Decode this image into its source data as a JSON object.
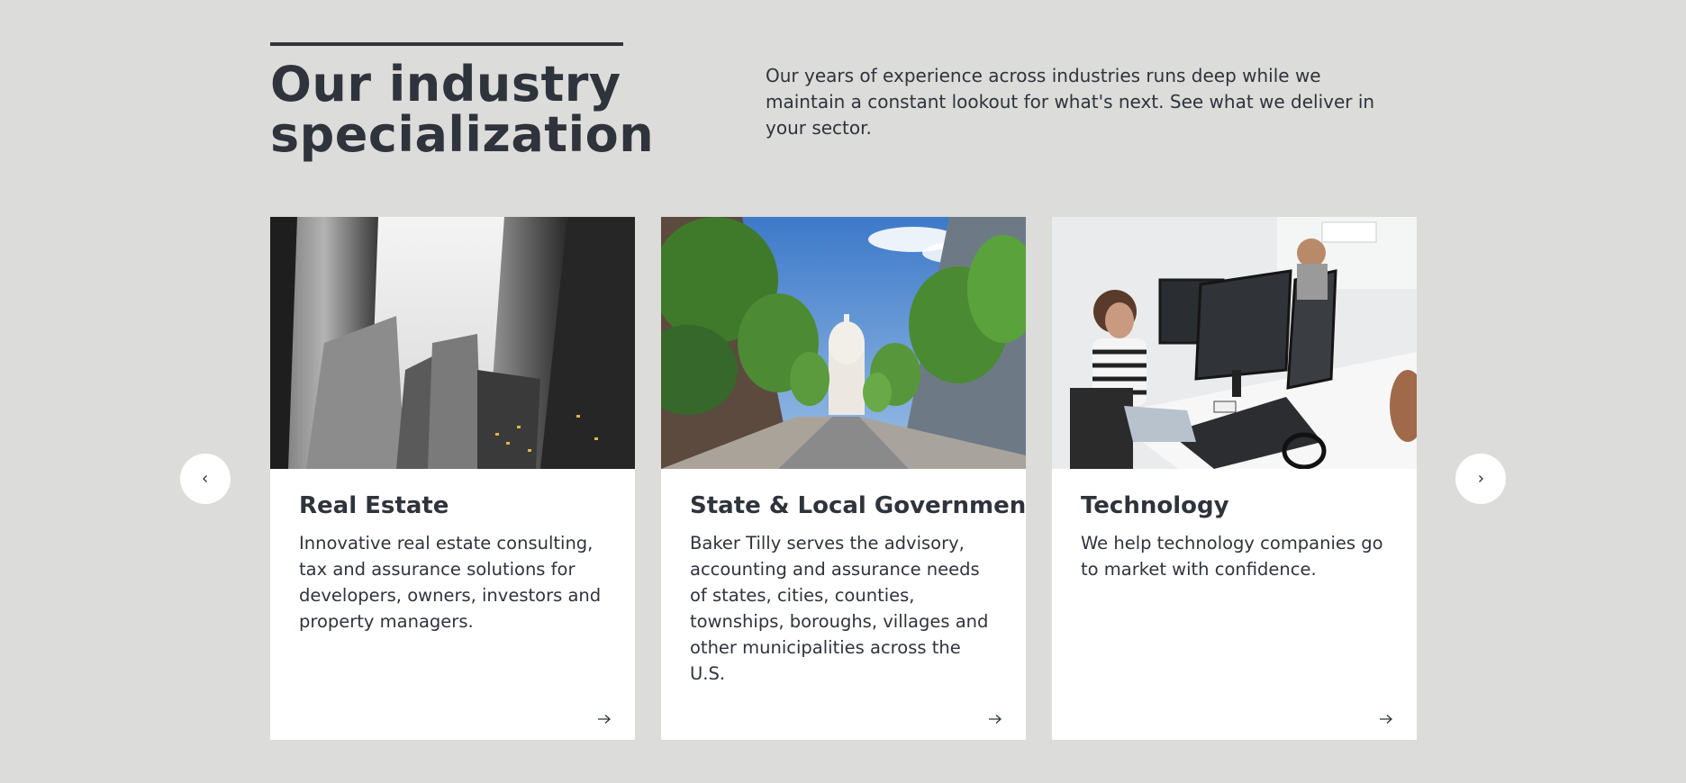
{
  "section": {
    "heading": "Our industry specialization",
    "intro": "Our years of experience across industries runs deep while we maintain a constant lookout for what's next. See what we deliver in your sector."
  },
  "carousel": {
    "prev_icon": "chevron-left-icon",
    "next_icon": "chevron-right-icon",
    "cards": [
      {
        "title": "Real Estate",
        "description": "Innovative real estate consulting, tax and assurance solutions for developers, owners, investors and property managers.",
        "image": "skyscrapers-photo",
        "icon": "arrow-right-icon"
      },
      {
        "title": "State & Local Government",
        "description": "Baker Tilly serves the advisory, accounting and assurance needs of states, cities, counties, townships, boroughs, villages and other municipalities across the U.S.",
        "image": "capitol-street-photo",
        "icon": "arrow-right-icon"
      },
      {
        "title": "Technology",
        "description": "We help technology companies go to market with confidence.",
        "image": "office-workers-photo",
        "icon": "arrow-right-icon"
      }
    ]
  },
  "colors": {
    "background": "#dcdcda",
    "text": "#2f333b",
    "card": "#ffffff"
  }
}
